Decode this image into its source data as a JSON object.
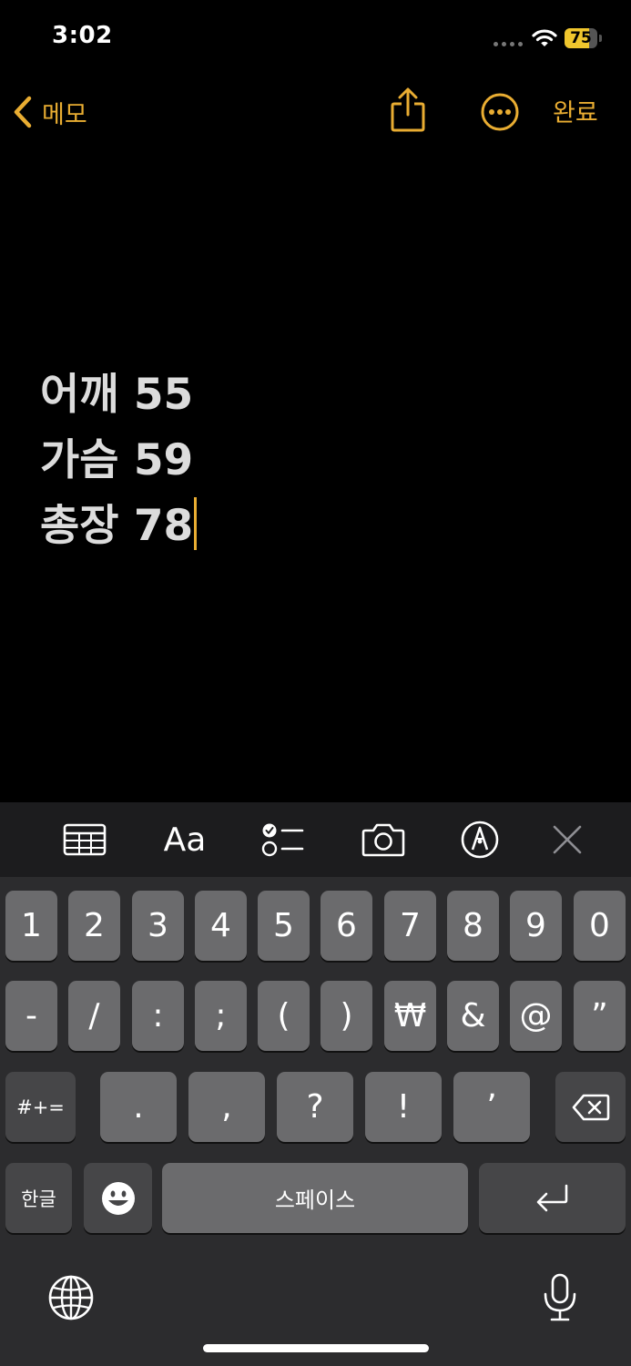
{
  "status_bar": {
    "time": "3:02",
    "battery_percent": 75,
    "battery_label": "75"
  },
  "nav": {
    "back_label": "메모",
    "done_label": "완료"
  },
  "note": {
    "lines": [
      "어깨 55",
      "가슴 59",
      "총장 78"
    ]
  },
  "toolbar": {
    "items": [
      "table-icon",
      "Aa",
      "checklist-icon",
      "camera-icon",
      "markup-icon",
      "close-icon"
    ],
    "format_label": "Aa"
  },
  "keyboard": {
    "row1": [
      "1",
      "2",
      "3",
      "4",
      "5",
      "6",
      "7",
      "8",
      "9",
      "0"
    ],
    "row2": [
      "-",
      "/",
      ":",
      ";",
      "(",
      ")",
      "₩",
      "&",
      "@",
      "”"
    ],
    "row3": {
      "mode": "#+=",
      "keys": [
        ".",
        ",",
        "?",
        "!",
        "’"
      ]
    },
    "row4": {
      "lang": "한글",
      "space": "스페이스"
    }
  },
  "colors": {
    "accent": "#e9ad32",
    "background": "#000000",
    "keyboard": "#2c2c2e",
    "key": "#6b6b6d"
  }
}
